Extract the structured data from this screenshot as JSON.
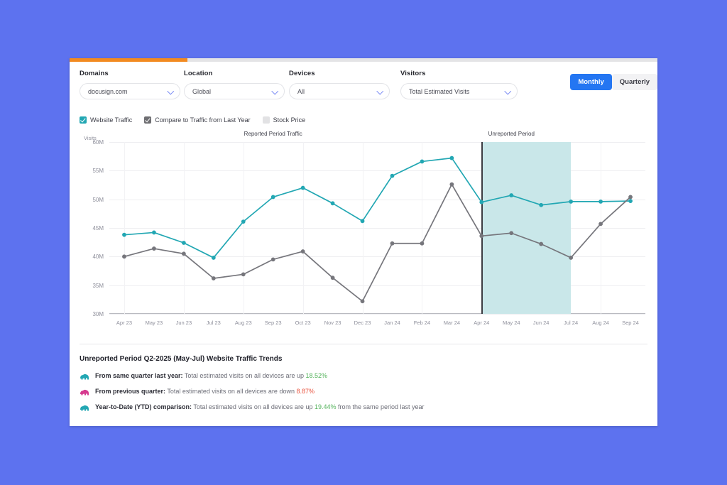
{
  "theme": {
    "background": "#5d72ef",
    "card_bg": "#ffffff",
    "accent_orange": "#f28a20",
    "accent_blue": "#2476f2",
    "teal": "#22a7b3",
    "gray_line": "#76767c",
    "shade": "#c9e7e9",
    "up_green": "#54b35c",
    "down_red": "#e8513c"
  },
  "progress": {
    "percent": 20
  },
  "filters": [
    {
      "label": "Domains",
      "value": "docusign.com",
      "icon": "chevron-down-icon"
    },
    {
      "label": "Location",
      "value": "Global",
      "icon": "chevron-down-icon"
    },
    {
      "label": "Devices",
      "value": "All",
      "icon": "chevron-down-icon"
    },
    {
      "label": "Visitors",
      "value": "Total Estimated Visits",
      "icon": "chevron-down-icon"
    }
  ],
  "period_toggle": {
    "monthly": "Monthly",
    "quarterly": "Quarterly",
    "selected": "Monthly"
  },
  "legend": [
    {
      "label": "Website Traffic",
      "checked": true,
      "color": "#22a7b3"
    },
    {
      "label": "Compare to Traffic from Last Year",
      "checked": true,
      "color": "#6e6e72"
    },
    {
      "label": "Stock Price",
      "checked": false,
      "color": "#e2e2e4"
    }
  ],
  "chart_data": {
    "type": "line",
    "title": "",
    "xlabel": "",
    "ylabel": "Visits",
    "ylim": [
      30,
      60
    ],
    "yticks": [
      "60M",
      "55M",
      "50M",
      "45M",
      "40M",
      "35M",
      "30M"
    ],
    "grid": true,
    "legend_position": "top",
    "categories": [
      "Apr 23",
      "May 23",
      "Jun 23",
      "Jul 23",
      "Aug 23",
      "Sep 23",
      "Oct 23",
      "Nov 23",
      "Dec 23",
      "Jan 24",
      "Feb 24",
      "Mar 24",
      "Apr 24",
      "May 24",
      "Jun 24",
      "Jul 24",
      "Aug 24",
      "Sep 24"
    ],
    "series": [
      {
        "name": "Website Traffic",
        "color": "#22a7b3",
        "values": [
          43.8,
          44.2,
          42.4,
          39.8,
          46.1,
          50.4,
          52.0,
          49.3,
          46.2,
          54.1,
          56.6,
          57.2,
          49.5,
          50.7,
          49.0,
          49.6,
          49.6,
          49.7
        ]
      },
      {
        "name": "Compare to Traffic from Last Year",
        "color": "#76767c",
        "values": [
          40.0,
          41.4,
          40.5,
          36.2,
          36.9,
          39.5,
          40.9,
          36.3,
          32.2,
          42.3,
          42.3,
          52.6,
          43.6,
          44.1,
          42.2,
          39.8,
          45.7,
          50.4
        ]
      }
    ],
    "annotations": [
      {
        "text": "Reported Period Traffic",
        "at": "Sep 23"
      },
      {
        "text": "Unreported Period",
        "at": "May 24"
      }
    ],
    "shaded_region": {
      "from": "Apr 24",
      "to": "Jul 24",
      "color": "#c9e7e9"
    },
    "divider_at": "Apr 24"
  },
  "insights": {
    "title": "Unreported Period Q2-2025 (May-Jul) Website Traffic Trends",
    "rows": [
      {
        "icon": "elephant-teal-icon",
        "icon_color": "#22a7b3",
        "label": "From same quarter last year:",
        "text_before": "Total estimated visits on all devices are up",
        "value": "18.52%",
        "direction": "up",
        "text_after": ""
      },
      {
        "icon": "elephant-pink-icon",
        "icon_color": "#d63a8f",
        "label": "From previous quarter:",
        "text_before": "Total estimated visits on all devices are down",
        "value": "8.87%",
        "direction": "down",
        "text_after": ""
      },
      {
        "icon": "elephant-teal-icon",
        "icon_color": "#22a7b3",
        "label": "Year-to-Date (YTD) comparison:",
        "text_before": "Total estimated visits on all devices are up",
        "value": "19.44%",
        "direction": "up",
        "text_after": "from the same period last year"
      }
    ]
  }
}
